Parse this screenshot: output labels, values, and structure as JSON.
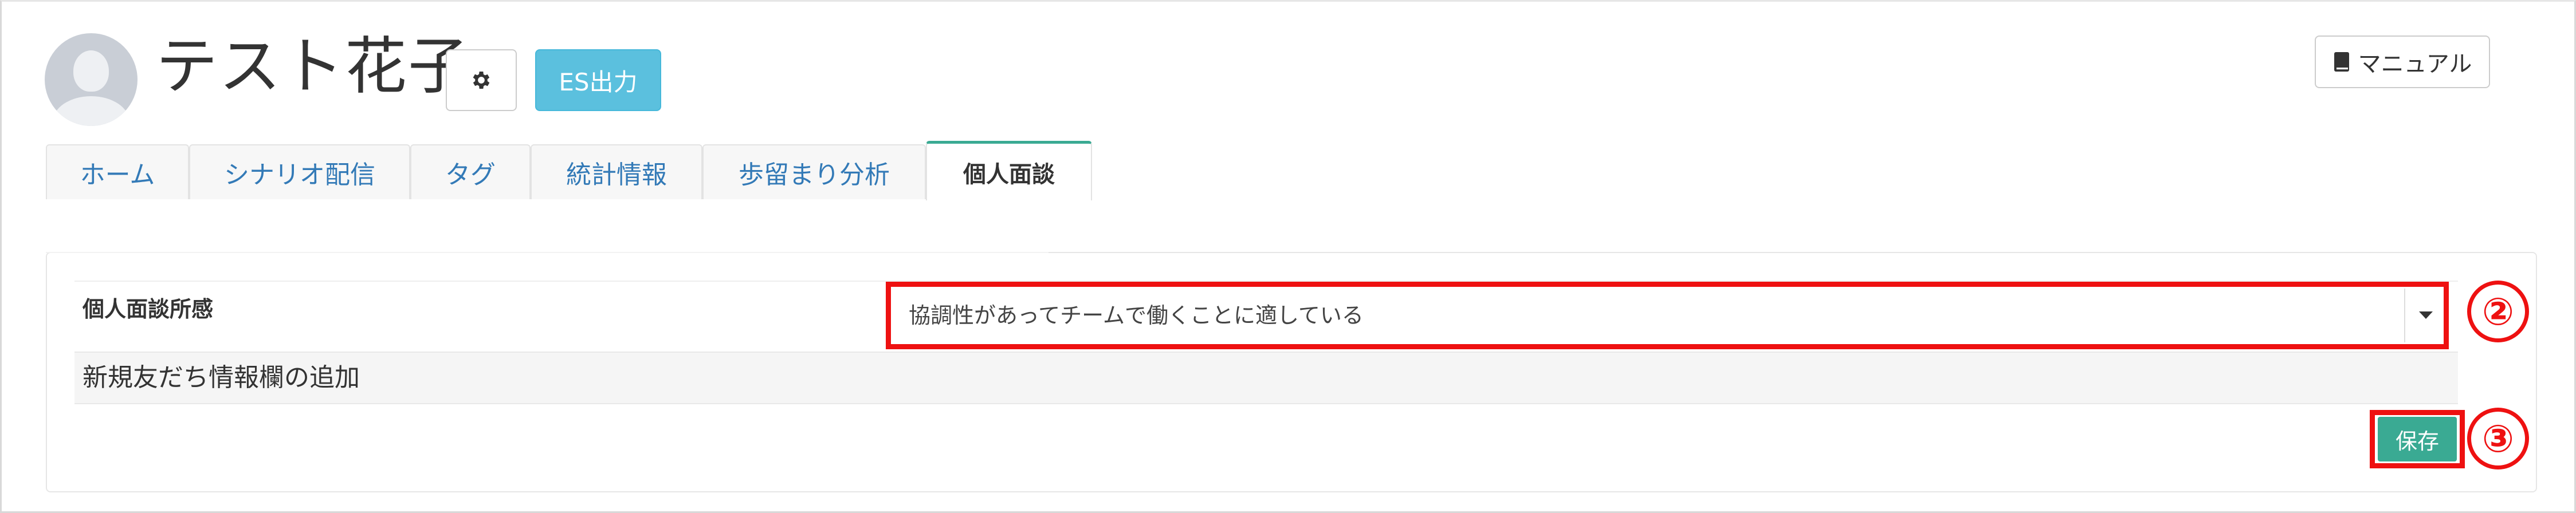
{
  "header": {
    "user_name": "テスト花子",
    "settings_icon": "gear-icon",
    "es_button_label": "ES出力",
    "manual_button_label": "マニュアル",
    "manual_icon": "book-icon"
  },
  "tabs": [
    {
      "label": "ホーム",
      "active": false
    },
    {
      "label": "シナリオ配信",
      "active": false
    },
    {
      "label": "タグ",
      "active": false
    },
    {
      "label": "統計情報",
      "active": false
    },
    {
      "label": "歩留まり分析",
      "active": false
    },
    {
      "label": "個人面談",
      "active": true
    }
  ],
  "form": {
    "field_label": "個人面談所感",
    "selected_value": "協調性があってチームで働くことに適している",
    "add_field_label": "新規友だち情報欄の追加",
    "save_label": "保存"
  },
  "annotations": {
    "marker_2": "②",
    "marker_3": "③",
    "highlight_color": "#ee1111"
  },
  "colors": {
    "accent_teal": "#3aaa93",
    "info_blue": "#5bc0de",
    "link_blue": "#337ab7"
  }
}
